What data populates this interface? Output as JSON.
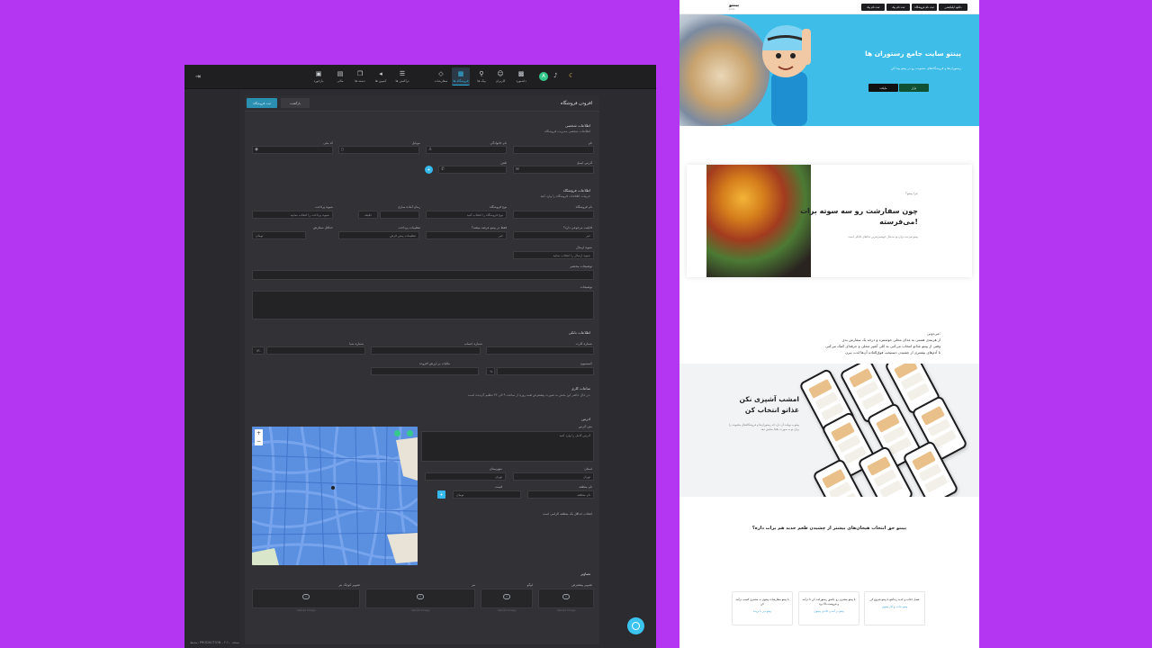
{
  "admin": {
    "nav_items": [
      {
        "label": "داشبورد",
        "icon": "dashboard-icon"
      },
      {
        "label": "کاربران",
        "icon": "users-icon"
      },
      {
        "label": "پیک ها",
        "icon": "bike-icon"
      },
      {
        "label": "فروشگاه ها",
        "icon": "store-icon",
        "active": true
      },
      {
        "label": "سفارشات",
        "icon": "diamond-icon"
      },
      {
        "label": "تراکنش ها",
        "icon": "receipt-icon"
      },
      {
        "label": "کمپین ها",
        "icon": "megaphone-icon"
      },
      {
        "label": "دسته ها",
        "icon": "copy-icon"
      },
      {
        "label": "مالی",
        "icon": "money-icon"
      },
      {
        "label": "بازخورد",
        "icon": "chat-icon"
      }
    ],
    "avatar_letter": "A",
    "page_title": "افزودن فروشگاه",
    "save_label": "ثبت فروشگاه",
    "back_label": "بازگشت",
    "personal_title": "اطلاعات شخصی",
    "personal_subtitle": "اطلاعات شخصی مدیریت فروشگاه",
    "fields": {
      "first_name": "نام",
      "last_name": "نام خانوادگی",
      "mobile": "موبایل",
      "national_code": "کد ملی",
      "email": "آدرس ایمیل",
      "phone": "تلفن"
    },
    "store_title": "اطلاعات فروشگاه",
    "store_subtitle": "جزییات اطلاعات فروشگاه را وارد کنید",
    "store_fields": {
      "store_name": "نام فروشگاه",
      "store_type": "نوع فروشگاه",
      "store_type_value": "نوع فروشگاه را انتخاب کنید",
      "prep_time": "زمان آماده سازی",
      "prep_time_unit": "دقیقه",
      "payment_method": "شیوه پرداخت",
      "payment_method_value": "شیوه پرداخت را انتخاب نمایید",
      "return_delivery": "قابلیت مرجوعی دارد؟",
      "return_value": "خیر",
      "pinto_delivery": "فقط در پینتو عرضه میشه؟",
      "pinto_value": "خیر",
      "settings": "تنظیمات پرداخت",
      "settings_value": "تنظیمات پیش فرض",
      "min_order": "حداقل سفارش",
      "min_order_value": "تومان",
      "send_method": "شیوه ارسال",
      "send_method_value": "شیوه ارسال را انتخاب نمایید",
      "short_desc": "توضیحات مختصر",
      "description": "توضیحات"
    },
    "bank_title": "اطلاعات بانکی",
    "bank_fields": {
      "card_number": "شماره کارت",
      "account_number": "شماره حساب",
      "sheba": "شماره شبا",
      "commission": "کمیسیون",
      "tax": "مالیات بر ارزش افزوده"
    },
    "hours_title": "ساعات کاری",
    "hours_subtitle": "در حال حاضر این بخش به صورت پیشفرض همه روزه از ساعت ۹ الی ۲۳ تنظیم گردیده است.",
    "address_title": "آدرس",
    "address_fields": {
      "full_address": "متن آدرس",
      "full_address_ph": "آدرس کامل را وارد کنید",
      "province": "استان",
      "province_value": "تهران",
      "city": "شهرستان",
      "city_value": "تهران",
      "area_name": "نام منطقه",
      "area_ph": "نام منطقه",
      "price": "قیمت",
      "price_value": "تومان",
      "map_hint": "انتخاب حداقل یک منطقه الزامی است"
    },
    "images_title": "تصاویر",
    "images": [
      "تصویر پیشفرض",
      "لوگو",
      "بنر",
      "تصویر کوچک بنر"
    ],
    "upload_hint": "Upload Image",
    "footer": "محیط: PRODUCTION - نسخه ۲.۶.۰"
  },
  "site": {
    "nav_buttons": [
      "دانلود اپلیکیشن",
      "ثبت نام فروشگاه",
      "ثبت نام پیک",
      "ثبت نام پیک"
    ],
    "logo": "پینتو",
    "logo_sub": "pinto",
    "hero_title": "پینتو سایت جامع رستوران ها",
    "hero_subtitle": "رستوران‌ها و فروشگاه‌های محبوبت رو در پینتو پیدا کن",
    "stores": [
      "بازار",
      "مایکت",
      "سیب اپ"
    ],
    "card_kicker": "چرا پینتو؟",
    "card_title_1": "چون سفارشت رو سه سوته برات",
    "card_title_2": "می‌فرسته!",
    "card_sub": "پینتو سرعت برای تو به‌دنبال خوشمزه‌ترین غذاهای خانگی است",
    "mid_kicker": "می‌دونی:",
    "mid_lines": [
      "از هزینه‌ی هستی به غذای محلی خوشمزه و درجه یک سفارش بدی",
      "وقتی از پینتو غذاتو انتخاب می‌کنی به کلی آشپز محلی و حرفه‌ای کمک می‌کنی",
      "تا آدم‌های بیشتری از چشیدن دستپخت فوق‌العاده آن‌ها لذت ببرن"
    ],
    "promo_title_1": "امشب آشپزی نکن",
    "promo_title_2": "غذاتو انتخاب کن",
    "promo_sub_1": "پینتو به نهایت آن دارد که رستوران‌ها و فروشگاه‌های محبوبت را",
    "promo_sub_2": "برای تو به صورت یکجا نمایش دهد",
    "question": "پینتو حق انتخاب هیجان‌های بیشتر از چشیدن طعم جدید هم برات داره؟",
    "features": [
      {
        "text": "با پینتو سفارشات پینتوی به مشتری کسب درآمد کن",
        "link": "پینتو دیر با بریده"
      },
      {
        "text": "با پینتو مشتری رو عاشق رستورانت کن تا درآمد و فروشت بالا بره",
        "link": "پینتو در آمد و خانه‌ی پینتوی"
      },
      {
        "text": "فصل جذاب و جدید زندگیتو با پینتو شروع کن",
        "link": "پینتو عادت و کار پینتوی"
      }
    ]
  }
}
